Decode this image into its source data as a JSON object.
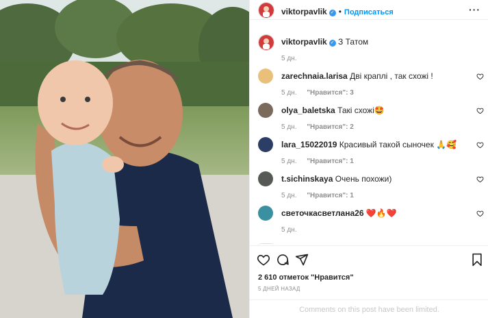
{
  "post": {
    "image_alt": "",
    "author": {
      "username": "viktorpavlik",
      "verified": true,
      "follow_label": "Подписаться"
    },
    "caption": {
      "username": "viktorpavlik",
      "text": "З Татом",
      "time": "5 дн."
    },
    "comments": [
      {
        "username": "zarechnaia.larisa",
        "text": "Дві краплі , так схожі !",
        "time": "5 дн.",
        "likes": "\"Нравится\": 3",
        "avatar_color": "#e8c07a"
      },
      {
        "username": "olya_baletska",
        "text": "Такі схожі🤩",
        "time": "5 дн.",
        "likes": "\"Нравится\": 2",
        "avatar_color": "#7a6a5c"
      },
      {
        "username": "lara_15022019",
        "text": "Красивый такой сыночек 🙏🥰",
        "time": "5 дн.",
        "likes": "\"Нравится\": 1",
        "avatar_color": "#2c3e66"
      },
      {
        "username": "t.sichinskaya",
        "text": "Очень похожи)",
        "time": "5 дн.",
        "likes": "\"Нравится\": 1",
        "avatar_color": "#555a55"
      },
      {
        "username": "светочкасветлана26",
        "text": "❤️🔥❤️",
        "time": "5 дн.",
        "likes": "",
        "avatar_color": "#3a8fa0"
      }
    ],
    "likes_total": "2 610 отметок \"Нравится\"",
    "date": "5 ДНЕЙ НАЗАД",
    "comments_limited": "Comments on this post have been limited."
  },
  "colors": {
    "accent": "#0095f6",
    "verified": "#3897f0",
    "muted": "#8e8e8e",
    "border": "#efefef"
  },
  "icons": [
    "heart-icon",
    "comment-icon",
    "share-icon",
    "bookmark-icon",
    "more-icon",
    "verified-icon"
  ]
}
